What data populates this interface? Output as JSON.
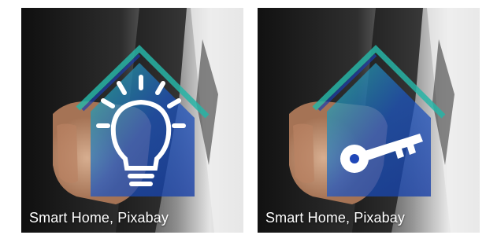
{
  "gallery": {
    "items": [
      {
        "caption": "Smart Home, Pixabay",
        "icon": "lightbulb-icon"
      },
      {
        "caption": "Smart Home, Pixabay",
        "icon": "key-icon"
      }
    ]
  },
  "colors": {
    "house_blue": "#1f47b8",
    "house_teal": "#28b7a8",
    "suit_dark": "#2a2a2a",
    "shirt_light": "#e9e9e9",
    "skin": "#c89b7b",
    "icon_white": "#ffffff"
  }
}
